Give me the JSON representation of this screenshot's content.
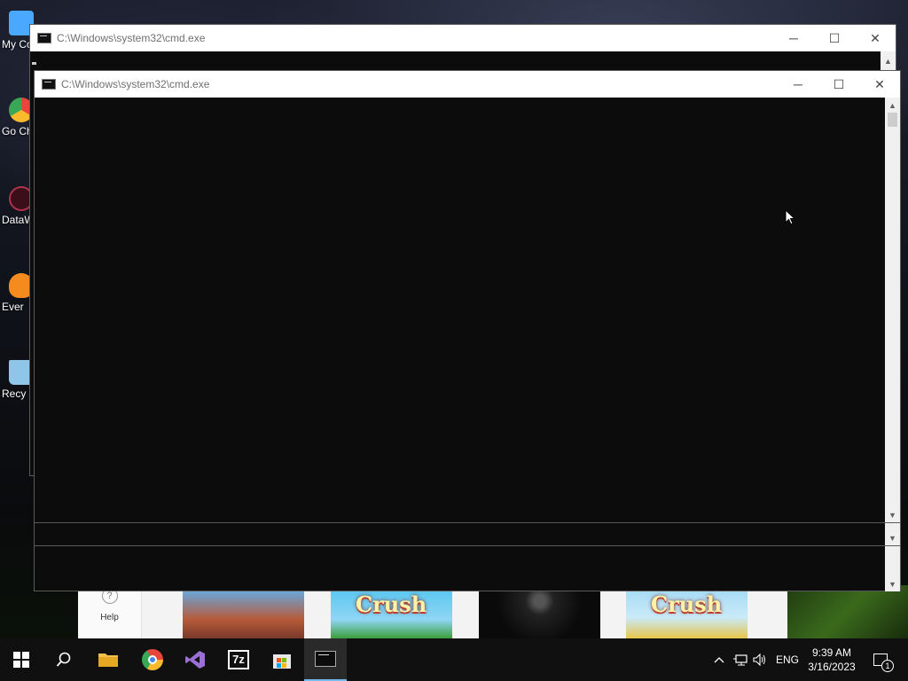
{
  "desktop": {
    "icons": [
      {
        "label": "My Co",
        "color": "#4aa8ff"
      },
      {
        "label": "Go Ch",
        "color": "#e8453c"
      },
      {
        "label": "DataW",
        "color": "#b0324e"
      },
      {
        "label": "Ever",
        "color": "#f58a1f"
      },
      {
        "label": "Recy",
        "color": "#8ec5e8"
      }
    ]
  },
  "back_window": {
    "title": "C:\\Windows\\system32\\cmd.exe"
  },
  "front_window": {
    "title": "C:\\Windows\\system32\\cmd.exe"
  },
  "window_buttons": {
    "minimize": "─",
    "maximize": "☐",
    "close": "✕"
  },
  "store": {
    "help_label": "Help",
    "help_icon": "?",
    "tiles": [
      {
        "name": "roblox-tile",
        "word": ""
      },
      {
        "name": "candy-crush-saga-tile",
        "word": "Crush"
      },
      {
        "name": "dark-game-tile",
        "word": ""
      },
      {
        "name": "candy-crush-soda-tile",
        "word": "Crush"
      }
    ]
  },
  "taskbar": {
    "clock_time": "9:39 AM",
    "clock_date": "3/16/2023",
    "language": "ENG",
    "notification_count": "1",
    "seven_zip_label": "7z",
    "accent": "#76b9ed"
  }
}
